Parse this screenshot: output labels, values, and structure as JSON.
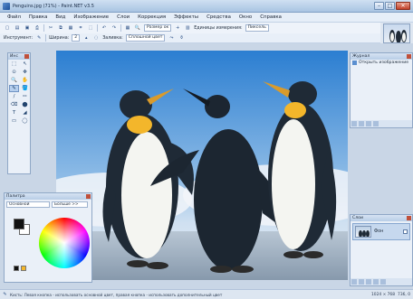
{
  "window": {
    "title": "Penguins.jpg (71%) - Paint.NET v3.5",
    "min_label": "–",
    "max_label": "□",
    "close_label": "✕"
  },
  "menu": [
    "Файл",
    "Правка",
    "Вид",
    "Изображение",
    "Слои",
    "Коррекция",
    "Эффекты",
    "Средства",
    "Окно",
    "Справка"
  ],
  "toolbar1": {
    "zoom_value": "Размер ок",
    "units_label": "Единицы измерения:",
    "units_value": "Пиксель"
  },
  "toolbar2": {
    "tool_label": "Инструмент:",
    "width_label": "Ширина:",
    "width_value": "2",
    "fill_label": "Заливка:",
    "fill_value": "Сплошной цвет"
  },
  "tools_panel": {
    "title": "Инс",
    "items": [
      "⬚",
      "↖",
      "⊙",
      "✥",
      "🔍",
      "✋",
      "✎",
      "🪣",
      "∕",
      "✏",
      "⌫",
      "⬤",
      "T",
      "◢",
      "▭",
      "◯"
    ]
  },
  "palette_panel": {
    "title": "Палитра",
    "mode_value": "Основной",
    "more_label": "Больше >>"
  },
  "history_panel": {
    "title": "Журнал",
    "items": [
      {
        "label": "Открыть изображение"
      }
    ]
  },
  "layers_panel": {
    "title": "Слои",
    "items": [
      {
        "name": "Фон"
      }
    ]
  },
  "status": {
    "text": "Кисть: Левая кнопка - использовать основной цвет, правая кнопка - использовать дополнительный цвет",
    "image_size": "1024 × 768",
    "cursor_pos": "736, 0"
  },
  "colors": {
    "sky_top": "#2b7ed1",
    "sky_bottom": "#cfe0f1",
    "sand": "#9fb2c5",
    "penguin_body": "#1f2a36",
    "penguin_chest": "#f4f5f1",
    "penguin_yellow": "#f3b62b"
  }
}
